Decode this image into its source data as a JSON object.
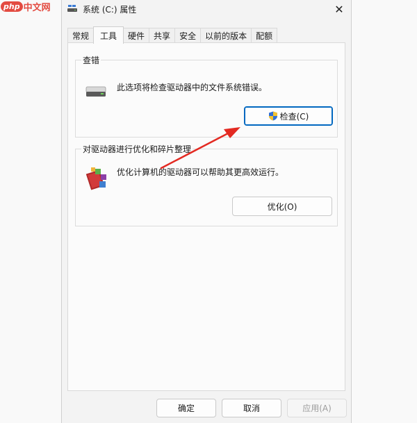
{
  "watermark": {
    "logo_php": "php",
    "logo_cn": "中文网"
  },
  "window": {
    "title": "系统 (C:) 属性",
    "close_symbol": "✕"
  },
  "tabs": [
    {
      "label": "常规",
      "active": false
    },
    {
      "label": "工具",
      "active": true
    },
    {
      "label": "硬件",
      "active": false
    },
    {
      "label": "共享",
      "active": false
    },
    {
      "label": "安全",
      "active": false
    },
    {
      "label": "以前的版本",
      "active": false
    },
    {
      "label": "配额",
      "active": false
    }
  ],
  "error_check": {
    "group_title": "查错",
    "description": "此选项将检查驱动器中的文件系统错误。",
    "button_label": "检查(C)",
    "icon": "drive-icon"
  },
  "optimize": {
    "group_title": "对驱动器进行优化和碎片整理",
    "description": "优化计算机的驱动器可以帮助其更高效运行。",
    "button_label": "优化(O)",
    "icon": "defrag-icon"
  },
  "footer": {
    "ok_label": "确定",
    "cancel_label": "取消",
    "apply_label": "应用(A)"
  },
  "colors": {
    "annotation_arrow": "#e32a22",
    "watermark": "#e34b41",
    "focus_border": "#0067c0"
  }
}
